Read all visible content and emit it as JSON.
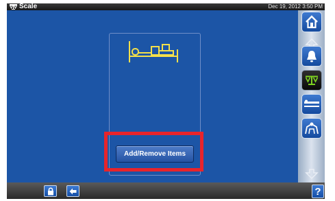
{
  "window": {
    "title": "Scale",
    "app_icon": "scale-icon",
    "datetime": "Dec 19, 2012 3:50 PM"
  },
  "main": {
    "bed_icon": "bed-items-icon",
    "add_remove_label": "Add/Remove Items",
    "highlight_color": "#e8242b"
  },
  "sidebar": {
    "items": [
      "home-icon",
      "scroll-up-icon",
      "alarm-bell-icon",
      "scale-icon",
      "bed-flat-icon",
      "patient-exit-icon",
      "scroll-down-icon"
    ],
    "active": "scale-icon"
  },
  "bottombar": {
    "lock_icon": "lock-icon",
    "back_icon": "back-arrow-icon",
    "help_label": "?"
  },
  "colors": {
    "background": "#1c55a6",
    "accent_yellow": "#f4e04a",
    "button_blue": "#2553a3"
  }
}
